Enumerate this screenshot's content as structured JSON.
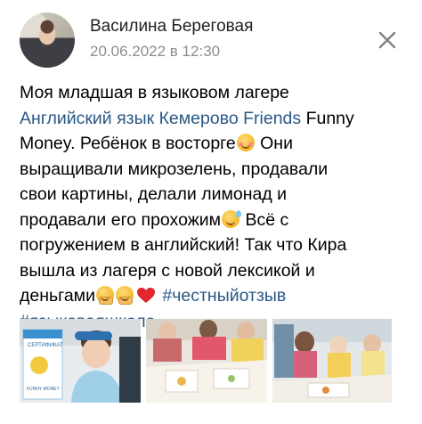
{
  "post": {
    "author": "Василина Береговая",
    "date": "20.06.2022 в 12:30",
    "text_lines": {
      "l1": "Моя младшая в языковом лагере",
      "l2_link": "Английский язык Кемерово Friends",
      "l2_rest": " Funny",
      "l3_a": "Money. Ребёнок в восторге",
      "l3_b": " Они",
      "l4": "выращивали микрозелень, продавали",
      "l5": "свои картины, делали лимонад и",
      "l6_a": "продавали его прохожим",
      "l6_b": " Всё с",
      "l7": "погружением в английский! Так что Кира",
      "l8": "вышла из лагеря с новой лексикой и",
      "l9_a": "деньгами",
      "l9_b": "#честныйотзыв",
      "l10": "#языковаяшкола"
    },
    "photos": [
      {
        "icon": "photo-child-certificate",
        "certificate_text": "СЕРТИФИКАТ",
        "sub_text": "FUNNY MONEY"
      },
      {
        "icon": "photo-children-table"
      },
      {
        "icon": "photo-children-crafts"
      }
    ]
  },
  "colors": {
    "link": "#2a5885",
    "date": "#8a8d91",
    "close_icon": "#7f8287",
    "heart": "#e0262e"
  },
  "icons": {
    "close": "close-icon",
    "emoji_1": "smiling-blush-emoji",
    "emoji_2": "grinning-sweat-emoji",
    "emoji_3": "hand-over-mouth-emoji",
    "emoji_4": "hand-over-mouth-emoji",
    "heart": "red-heart-emoji"
  }
}
